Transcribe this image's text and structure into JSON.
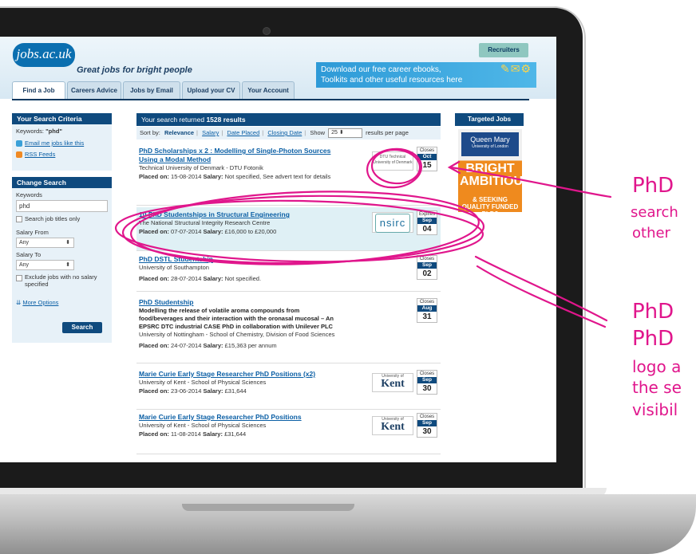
{
  "site": {
    "logo": "jobs.ac.uk",
    "tagline": "Great jobs for bright people",
    "recruiters": "Recruiters",
    "banner_line1": "Download our free career ebooks,",
    "banner_line2": "Toolkits and other useful resources here",
    "tabs": [
      "Find a Job",
      "Careers Advice",
      "Jobs by Email",
      "Upload your CV",
      "Your Account"
    ]
  },
  "criteria": {
    "heading": "Your Search Criteria",
    "keywords_label": "Keywords:",
    "keywords_value": "\"phd\"",
    "email_link": "Email me jobs like this",
    "rss_link": "RSS Feeds"
  },
  "change": {
    "heading": "Change Search",
    "keywords_label": "Keywords",
    "keywords_value": "phd",
    "title_only": "Search job titles only",
    "salary_from_label": "Salary From",
    "salary_from_value": "Any",
    "salary_to_label": "Salary To",
    "salary_to_value": "Any",
    "exclude": "Exclude jobs with no salary specified",
    "more_options": "More Options",
    "search_button": "Search"
  },
  "results": {
    "heading_pre": "Your search returned",
    "count": "1528 results",
    "sort_label": "Sort by:",
    "sort_options": [
      "Relevance",
      "Salary",
      "Date Placed",
      "Closing Date"
    ],
    "show_label": "Show",
    "per_page": "25",
    "per_page_suffix": "results per page",
    "placed_label": "Placed on:",
    "salary_label": "Salary:"
  },
  "jobs": [
    {
      "title": "PhD Scholarships x 2 : Modelling of Single-Photon Sources Using a Modal Method",
      "employer": "Technical University of Denmark - DTU Fotonik",
      "placed": "15-08-2014",
      "salary": "Not specified, See advert text for details",
      "date_label": "Closes",
      "month": "Oct",
      "day": "15",
      "logo": "DTU Technical University of Denmark"
    },
    {
      "title": "10 PhD Studentships in Structural Engineering",
      "employer": "The National Structural Integrity Research Centre",
      "placed": "07-07-2014",
      "salary": "£16,000 to £20,000",
      "date_label": "Expires",
      "month": "Sep",
      "day": "04",
      "logo": "nsirc"
    },
    {
      "title": "PhD DSTL Studentship",
      "employer": "University of Southampton",
      "placed": "28-07-2014",
      "salary": "Not specified.",
      "date_label": "Closes",
      "month": "Sep",
      "day": "02"
    },
    {
      "title": "PhD Studentship",
      "desc": "Modelling the release of volatile aroma compounds from food/beverages and their interaction with the oronasal mucosal – An EPSRC DTC industrial CASE PhD in collaboration with Unilever PLC",
      "employer": "University of Nottingham - School of Chemistry, Division of Food Sciences",
      "placed": "24-07-2014",
      "salary": "£15,363 per annum",
      "date_label": "Closes",
      "month": "Aug",
      "day": "31"
    },
    {
      "title": "Marie Curie Early Stage Researcher PhD Positions (x2)",
      "employer": "University of Kent - School of Physical Sciences",
      "placed": "23-06-2014",
      "salary": "£31,644",
      "date_label": "Closes",
      "month": "Sep",
      "day": "30",
      "logo_small": "University of",
      "logo": "Kent"
    },
    {
      "title": "Marie Curie Early Stage Researcher PhD Positions",
      "employer": "University of Kent - School of Physical Sciences",
      "placed": "11-08-2014",
      "salary": "£31,644",
      "date_label": "Closes",
      "month": "Sep",
      "day": "30",
      "logo_small": "University of",
      "logo": "Kent"
    }
  ],
  "targeted": {
    "heading": "Targeted Jobs",
    "ad_org": "Queen Mary",
    "ad_org_sub": "University of London",
    "ad_big": "BRIGHT AMBITIOUS",
    "ad_small": "& SEEKING QUALITY FUNDED PhD?"
  },
  "annotations": {
    "a1_line1": "PhD",
    "a1_line2": "search",
    "a1_line3": "other",
    "a2_line1": "PhD",
    "a2_line2": "PhD",
    "a2_line3": "logo a",
    "a2_line4": "the se",
    "a2_line5": "visibil"
  },
  "colors": {
    "brand_navy": "#0f4a7e",
    "link_blue": "#0b5fa5",
    "annotation_pink": "#e0168c",
    "highlight": "#dff0f5"
  }
}
